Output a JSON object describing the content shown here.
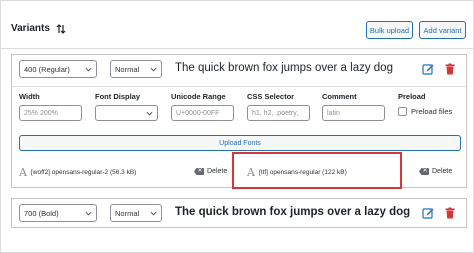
{
  "header": {
    "title": "Variants",
    "bulk_upload": "Bulk upload",
    "add_variant": "Add variant"
  },
  "variant1": {
    "weight": "400 (Regular)",
    "style": "Normal",
    "preview": "The quick brown fox jumps over a lazy dog",
    "fields": {
      "width_label": "Width",
      "width_placeholder": "25% 200%",
      "display_label": "Font Display",
      "display_value": "",
      "unicode_label": "Unicode Range",
      "unicode_placeholder": "U+0000-00FF",
      "css_label": "CSS Selector",
      "css_placeholder": "h1, h2, .poetry,",
      "comment_label": "Comment",
      "comment_placeholder": "latin",
      "preload_label": "Preload",
      "preload_checkbox_label": "Preload files"
    },
    "upload_label": "Upload Fonts",
    "files": [
      {
        "name": "[woff2] opensans-regular-2 (56.3 kB)",
        "delete": "Delete"
      },
      {
        "name": "[ttf] opensans-regular (122 kB)",
        "delete": "Delete"
      }
    ]
  },
  "variant2": {
    "weight": "700 (Bold)",
    "style": "Normal",
    "preview": "The quick brown fox jumps over a lazy dog"
  },
  "colors": {
    "accent": "#2271b1",
    "danger": "#d63638",
    "highlight": "#d63638"
  },
  "icons": {
    "sort": "sort-arrows-icon",
    "edit": "edit-icon",
    "trash": "trash-icon",
    "font": "font-file-icon",
    "delete": "delete-backspace-icon",
    "chevron": "chevron-down-icon"
  }
}
